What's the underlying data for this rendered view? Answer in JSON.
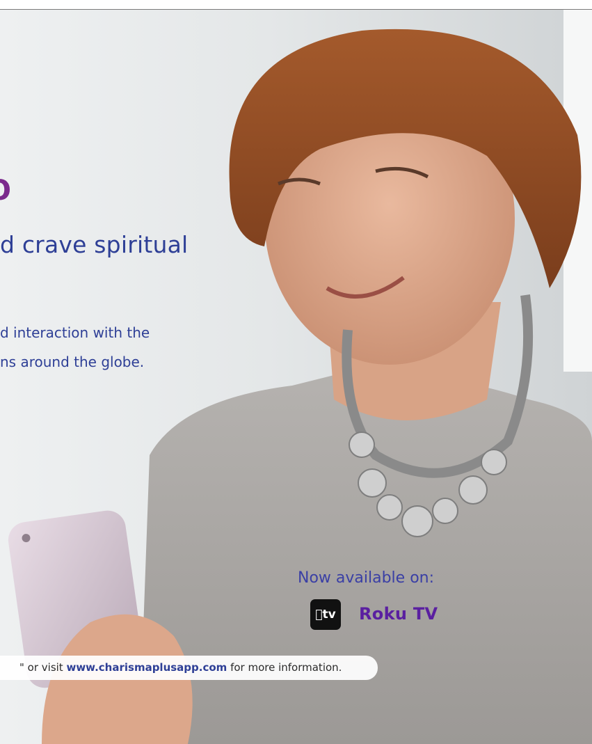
{
  "headline": "d crave spiritual",
  "body_lines": [
    "d interaction with the",
    "ns around the globe."
  ],
  "brand_glyph": "O",
  "availability": {
    "label": "Now available on:",
    "apple_tv_label": "tv",
    "roku_label": "Roku TV"
  },
  "banner": {
    "prefix": "\" or visit ",
    "url": "www.charismaplusapp.com",
    "suffix": " for more information."
  },
  "colors": {
    "headline": "#2e3f96",
    "brand_purple": "#7b2a8d",
    "roku_purple": "#5a1fa0"
  }
}
